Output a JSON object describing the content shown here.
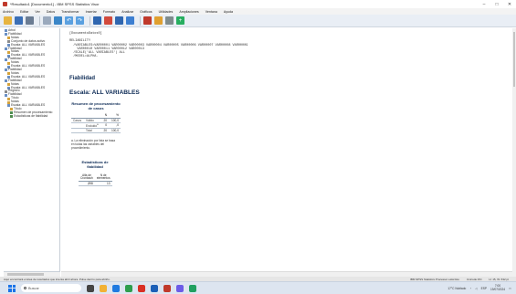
{
  "window": {
    "title": "*Resultado1 [Documento1] - IBM SPSS Statistics Visor"
  },
  "menu": [
    "Archivo",
    "Editar",
    "Ver",
    "Datos",
    "Transformar",
    "Insertar",
    "Formato",
    "Analizar",
    "Gráficos",
    "Utilidades",
    "Ampliaciones",
    "Ventana",
    "Ayuda"
  ],
  "tree": [
    {
      "label": "Arbol",
      "level": 0,
      "icon": "book"
    },
    {
      "label": "Fiabilidad",
      "level": 0,
      "icon": "book"
    },
    {
      "label": "Notas",
      "level": 1,
      "icon": "note"
    },
    {
      "label": "Conjunto de datos activo",
      "level": 1,
      "icon": "log"
    },
    {
      "label": "Escala: ALL VARIABLES",
      "level": 1,
      "icon": "book"
    },
    {
      "label": "Fiabilidad",
      "level": 0,
      "icon": "book"
    },
    {
      "label": "Notas",
      "level": 1,
      "icon": "note"
    },
    {
      "label": "Escala: ALL VARIABLES",
      "level": 1,
      "icon": "book"
    },
    {
      "label": "Fiabilidad",
      "level": 0,
      "icon": "book"
    },
    {
      "label": "Notas",
      "level": 1,
      "icon": "note"
    },
    {
      "label": "Escala: ALL VARIABLES",
      "level": 1,
      "icon": "book"
    },
    {
      "label": "Fiabilidad",
      "level": 0,
      "icon": "book"
    },
    {
      "label": "Notas",
      "level": 1,
      "icon": "note"
    },
    {
      "label": "Escala: ALL VARIABLES",
      "level": 1,
      "icon": "book"
    },
    {
      "label": "Fiabilidad",
      "level": 0,
      "icon": "book"
    },
    {
      "label": "Notas",
      "level": 1,
      "icon": "note"
    },
    {
      "label": "Escala: ALL VARIABLES",
      "level": 1,
      "icon": "book"
    },
    {
      "label": "Registro",
      "level": 0,
      "icon": "log"
    },
    {
      "label": "Fiabilidad",
      "level": 0,
      "icon": "book"
    },
    {
      "label": "Título",
      "level": 1,
      "icon": "note"
    },
    {
      "label": "Notas",
      "level": 1,
      "icon": "note"
    },
    {
      "label": "Escala: ALL VARIABLES",
      "level": 1,
      "icon": "book"
    },
    {
      "label": "Título",
      "level": 2,
      "icon": "note"
    },
    {
      "label": "Resumen de procesamiento",
      "level": 2,
      "icon": "table"
    },
    {
      "label": "Estadísticas de fiabilidad",
      "level": 2,
      "icon": "table"
    }
  ],
  "syntax": "[DocumentoDatos0]\n\nRELIABILITY\n  /VARIABLES=VAR00001 VAR00002 VAR00003 VAR00004 VAR00005 VAR00006 VAR00007 VAR00008 VAR00009\n    VAR00010 VAR00011 VAR00012 VAR00013\n  /SCALE('ALL VARIABLES') ALL\n  /MODEL=ALPHA.",
  "heading1": "Fiabilidad",
  "heading2": "Escala: ALL VARIABLES",
  "summary_table": {
    "title": "Resumen de procesamiento de casos",
    "col_headers": [
      "",
      "",
      "N",
      "%"
    ],
    "rows": [
      [
        "Casos",
        "Válido",
        "20",
        "100,0"
      ],
      [
        "",
        "Excluido",
        "0",
        ",0"
      ],
      [
        "",
        "Total",
        "20",
        "100,0"
      ]
    ],
    "excluded_marker": "a",
    "footnote": "a. La eliminación por lista se basa en todas las variables del procedimiento."
  },
  "reliability_table": {
    "title": "Estadísticas de fiabilidad",
    "col_headers": [
      "Alfa de Cronbach",
      "N de elementos"
    ],
    "row": [
      ",898",
      "13"
    ]
  },
  "statusbar": {
    "left": "Aquí encontrará el área de resultados que intenta abrir ahora. Pulse dentro para abrirlo.",
    "right1": "IBM SPSS Statistics Processor está listo",
    "right2": "Unicode:ON",
    "right3": "H: 15, W: 632 pt"
  },
  "taskbar": {
    "search_placeholder": "Buscar",
    "weather": "17°C Nublado",
    "lang": "ESP",
    "time": "7:00",
    "date": "19/07/2024"
  },
  "colors": {
    "heading": "#0c2a55",
    "accent": "#1a73e8"
  }
}
